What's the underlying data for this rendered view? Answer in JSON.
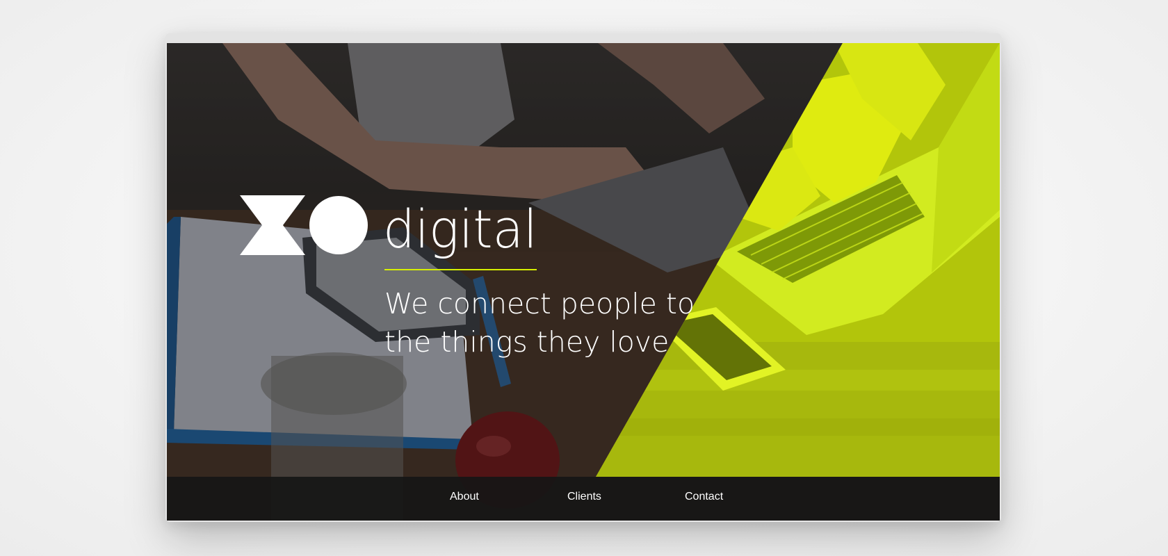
{
  "brand": {
    "name": "digital",
    "logo_icon": "xo-logo-icon",
    "accent_color": "#d7f000"
  },
  "hero": {
    "tagline_line1": "We connect people to",
    "tagline_line2": "the things they love",
    "background": "photo of people working at a laptop on a wooden table"
  },
  "nav": {
    "items": [
      {
        "label": "About"
      },
      {
        "label": "Clients"
      },
      {
        "label": "Contact"
      }
    ]
  },
  "colors": {
    "accent": "#d7f000",
    "nav_bg": "#161616",
    "text": "#ffffff"
  }
}
